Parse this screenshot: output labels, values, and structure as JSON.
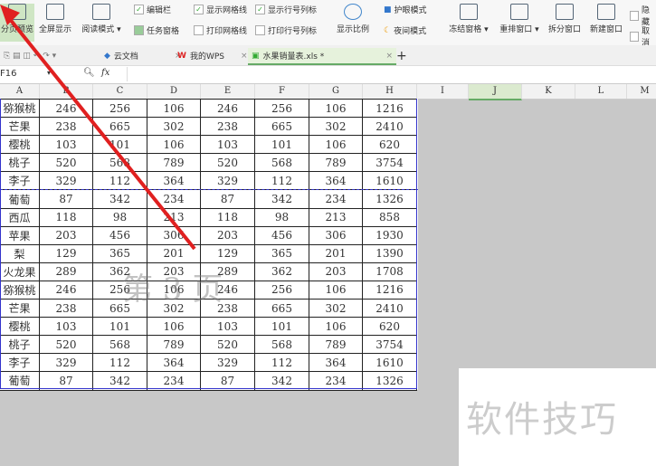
{
  "ribbon": {
    "page_preview": "分页预览",
    "fullscreen": "全屏显示",
    "reading_mode": "阅读模式 ▾",
    "edit_bar": "编辑栏",
    "task_pane": "任务窗格",
    "show_gridlines": "显示网格线",
    "show_headers": "显示行号列标",
    "print_gridlines": "打印网格线",
    "print_headers": "打印行号列标",
    "zoom": "显示比例",
    "eye_mode": "护眼模式",
    "night_mode": "夜间模式",
    "freeze": "冻结窗格 ▾",
    "rearrange": "重排窗口 ▾",
    "split": "拆分窗口",
    "new_window": "新建窗口",
    "hide": "隐藏",
    "cancel": "取消"
  },
  "tabs": {
    "cloud": "云文档",
    "mywps": "我的WPS",
    "file": "水果销量表.xls *"
  },
  "formula": {
    "cell_ref": "F16",
    "fx": "fx"
  },
  "columns": [
    "A",
    "B",
    "C",
    "D",
    "E",
    "F",
    "G",
    "H",
    "I",
    "J",
    "K",
    "L",
    "M"
  ],
  "rows": [
    [
      "猕猴桃",
      "246",
      "256",
      "106",
      "246",
      "256",
      "106",
      "1216"
    ],
    [
      "芒果",
      "238",
      "665",
      "302",
      "238",
      "665",
      "302",
      "2410"
    ],
    [
      "樱桃",
      "103",
      "101",
      "106",
      "103",
      "101",
      "106",
      "620"
    ],
    [
      "桃子",
      "520",
      "568",
      "789",
      "520",
      "568",
      "789",
      "3754"
    ],
    [
      "李子",
      "329",
      "112",
      "364",
      "329",
      "112",
      "364",
      "1610"
    ],
    [
      "葡萄",
      "87",
      "342",
      "234",
      "87",
      "342",
      "234",
      "1326"
    ],
    [
      "西瓜",
      "118",
      "98",
      "213",
      "118",
      "98",
      "213",
      "858"
    ],
    [
      "苹果",
      "203",
      "456",
      "306",
      "203",
      "456",
      "306",
      "1930"
    ],
    [
      "梨",
      "129",
      "365",
      "201",
      "129",
      "365",
      "201",
      "1390"
    ],
    [
      "火龙果",
      "289",
      "362",
      "203",
      "289",
      "362",
      "203",
      "1708"
    ],
    [
      "猕猴桃",
      "246",
      "256",
      "106",
      "246",
      "256",
      "106",
      "1216"
    ],
    [
      "芒果",
      "238",
      "665",
      "302",
      "238",
      "665",
      "302",
      "2410"
    ],
    [
      "樱桃",
      "103",
      "101",
      "106",
      "103",
      "101",
      "106",
      "620"
    ],
    [
      "桃子",
      "520",
      "568",
      "789",
      "520",
      "568",
      "789",
      "3754"
    ],
    [
      "李子",
      "329",
      "112",
      "364",
      "329",
      "112",
      "364",
      "1610"
    ],
    [
      "葡萄",
      "87",
      "342",
      "234",
      "87",
      "342",
      "234",
      "1326"
    ]
  ],
  "page_watermark": "第 3 页",
  "corner_watermark": "软件技巧"
}
